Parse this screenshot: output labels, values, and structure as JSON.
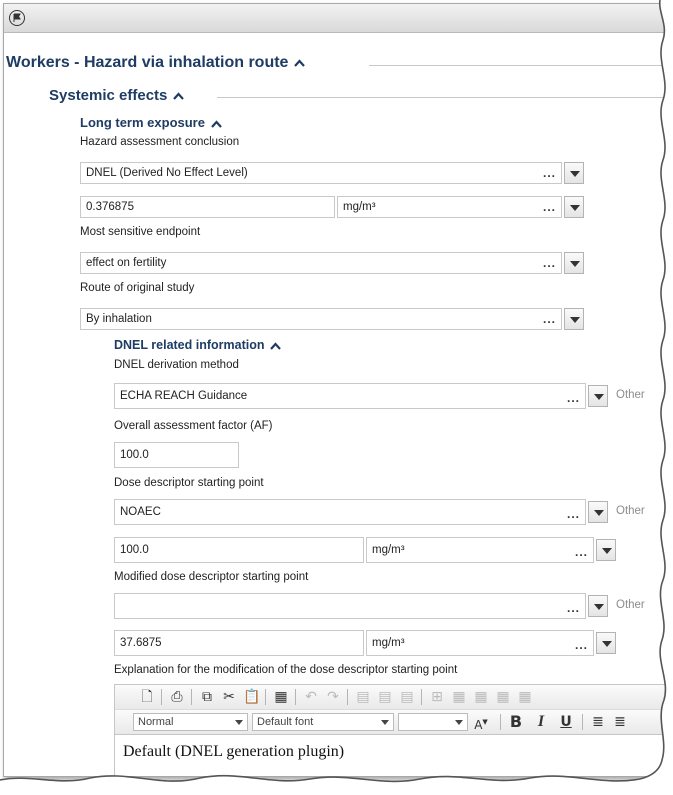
{
  "title": "Workers - Hazard via inhalation route",
  "systemic": {
    "heading": "Systemic effects",
    "long_term": {
      "heading": "Long term exposure",
      "hac_label": "Hazard assessment conclusion",
      "hac_value": "DNEL (Derived No Effect Level)",
      "value": "0.376875",
      "unit": "mg/m³",
      "mse_label": "Most sensitive endpoint",
      "mse_value": "effect on fertility",
      "route_label": "Route of original study",
      "route_value": "By inhalation"
    }
  },
  "dnel": {
    "heading": "DNEL related information",
    "method_label": "DNEL derivation method",
    "method_value": "ECHA REACH Guidance",
    "other_label": "Other",
    "af_label": "Overall assessment factor (AF)",
    "af_value": "100.0",
    "dose_label": "Dose descriptor starting point",
    "dose_value": "NOAEC",
    "dose_num": "100.0",
    "dose_unit": "mg/m³",
    "mod_label": "Modified dose descriptor starting point",
    "mod_value": "",
    "mod_num": "37.6875",
    "mod_unit": "mg/m³",
    "explanation_label": "Explanation for the modification of the dose descriptor starting point"
  },
  "editor": {
    "style_value": "Normal",
    "font_value": "Default font",
    "size_value": "",
    "content": "Default (DNEL generation plugin)"
  },
  "dots": "...",
  "icons": [
    "flag-icon",
    "collapse-icon",
    "dropdown-icon",
    "new-document-icon",
    "print-icon",
    "copy-icon",
    "cut-icon",
    "paste-icon",
    "table-icon",
    "undo-icon",
    "redo-icon",
    "bold-icon",
    "italic-icon",
    "underline-icon",
    "align-left-icon"
  ]
}
